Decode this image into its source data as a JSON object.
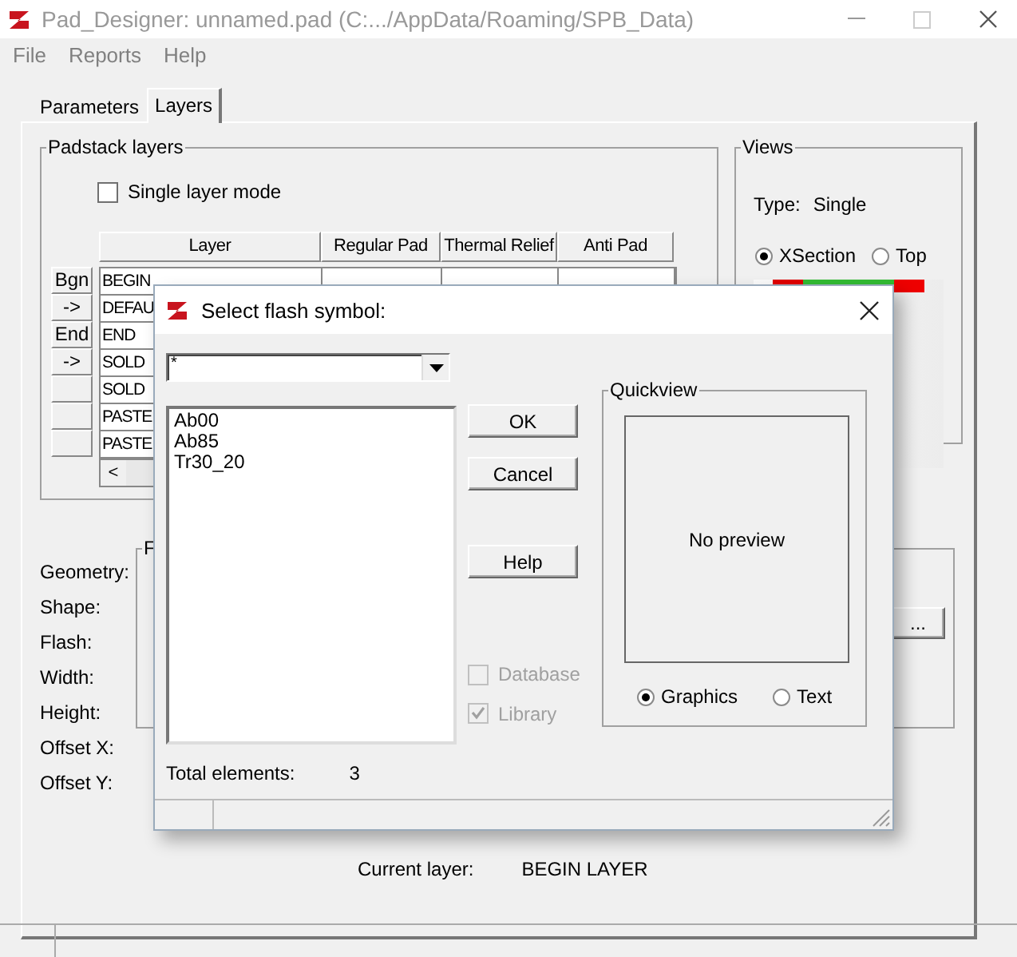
{
  "window": {
    "title": "Pad_Designer: unnamed.pad (C:.../AppData/Roaming/SPB_Data)"
  },
  "menu": [
    "File",
    "Reports",
    "Help"
  ],
  "tabs": [
    {
      "label": "Parameters",
      "selected": false
    },
    {
      "label": "Layers",
      "selected": true
    }
  ],
  "padstack_layers": {
    "title": "Padstack layers",
    "single_layer_mode": {
      "label": "Single layer mode",
      "checked": false
    },
    "columns": [
      "Layer",
      "Regular Pad",
      "Thermal Relief",
      "Anti Pad"
    ],
    "rows": [
      {
        "button": "Bgn",
        "layer": "BEGIN"
      },
      {
        "button": "->",
        "layer": "DEFAU"
      },
      {
        "button": "End",
        "layer": "END"
      },
      {
        "button": "->",
        "layer": "SOLD"
      },
      {
        "layer": "SOLD"
      },
      {
        "layer": "PASTE"
      },
      {
        "layer": "PASTE"
      }
    ],
    "scroll_left": "<"
  },
  "views": {
    "title": "Views",
    "type_label": "Type:",
    "type_value": "Single",
    "radios": [
      {
        "label": "XSection",
        "selected": true
      },
      {
        "label": "Top",
        "selected": false
      }
    ]
  },
  "pad_fields": {
    "group_title": "F",
    "labels": [
      "Geometry:",
      "Shape:",
      "Flash:",
      "Width:",
      "Height:",
      "Offset X:",
      "Offset Y:"
    ],
    "browse_button": "..."
  },
  "current_layer": {
    "label": "Current layer:",
    "value": "BEGIN LAYER"
  },
  "dialog": {
    "title": "Select flash symbol:",
    "filter": "*",
    "symbols": [
      "Ab00",
      "Ab85",
      "Tr30_20"
    ],
    "buttons": [
      "OK",
      "Cancel",
      "Help"
    ],
    "checkboxes": [
      {
        "label": "Database",
        "checked": false,
        "disabled": true
      },
      {
        "label": "Library",
        "checked": true,
        "disabled": true
      }
    ],
    "quickview": {
      "title": "Quickview",
      "message": "No preview",
      "radios": [
        {
          "label": "Graphics",
          "selected": true
        },
        {
          "label": "Text",
          "selected": false
        }
      ]
    },
    "total_label": "Total elements:",
    "total_value": "3"
  }
}
